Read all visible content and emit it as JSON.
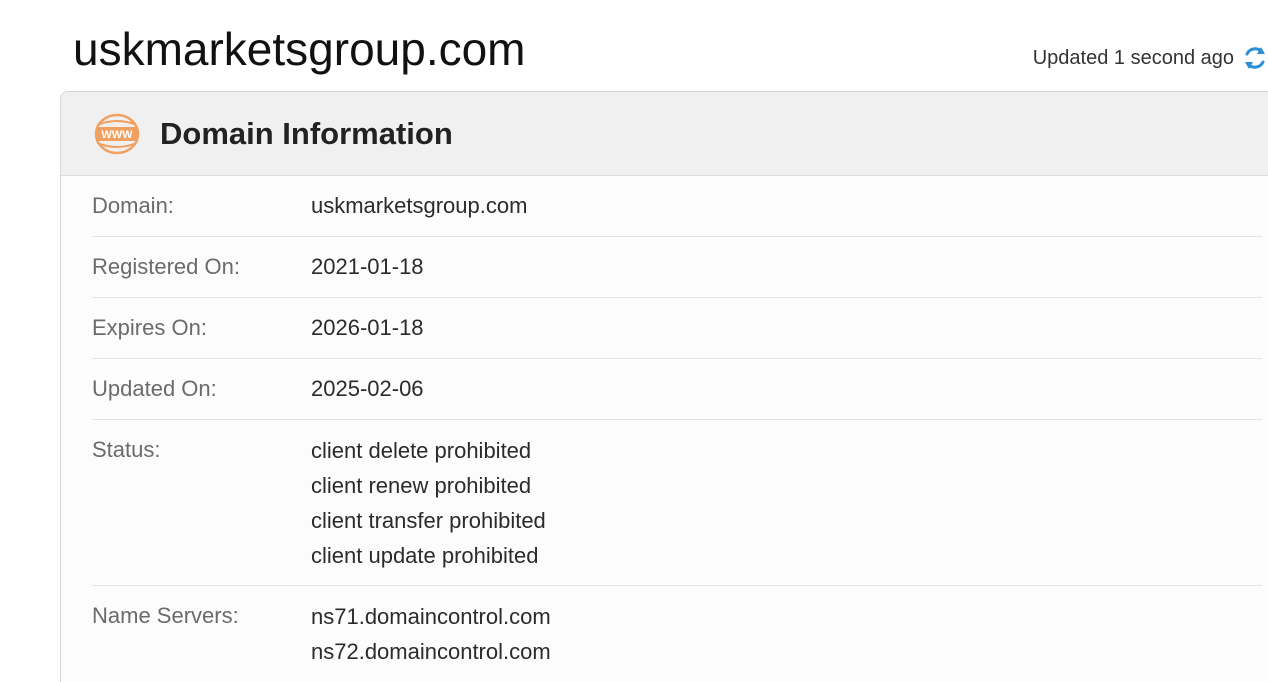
{
  "page": {
    "domain_title": "uskmarketsgroup.com",
    "updated_text": "Updated 1 second ago",
    "refresh_icon": "refresh-icon",
    "accent_color": "#2a8fd6"
  },
  "card": {
    "title": "Domain Information",
    "icon": "www-icon",
    "icon_color": "#f0a060",
    "icon_text": "WWW"
  },
  "info": {
    "domain": {
      "label": "Domain:",
      "value": "uskmarketsgroup.com"
    },
    "registered": {
      "label": "Registered On:",
      "value": "2021-01-18"
    },
    "expires": {
      "label": "Expires On:",
      "value": "2026-01-18"
    },
    "updated": {
      "label": "Updated On:",
      "value": "2025-02-06"
    },
    "status": {
      "label": "Status:",
      "values": [
        "client delete prohibited",
        "client renew prohibited",
        "client transfer prohibited",
        "client update prohibited"
      ]
    },
    "name_servers": {
      "label": "Name Servers:",
      "values": [
        "ns71.domaincontrol.com",
        "ns72.domaincontrol.com"
      ]
    }
  }
}
